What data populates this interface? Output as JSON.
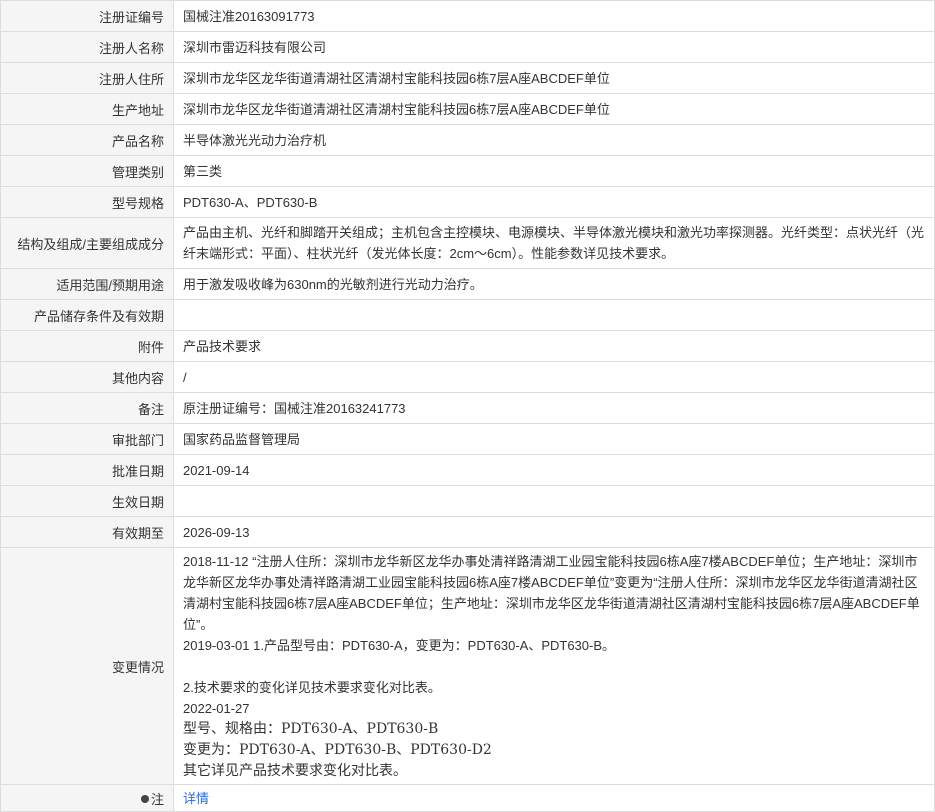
{
  "rows": [
    {
      "label": "注册证编号",
      "value": "国械注准20163091773"
    },
    {
      "label": "注册人名称",
      "value": "深圳市雷迈科技有限公司"
    },
    {
      "label": "注册人住所",
      "value": "深圳市龙华区龙华街道清湖社区清湖村宝能科技园6栋7层A座ABCDEF单位"
    },
    {
      "label": "生产地址",
      "value": "深圳市龙华区龙华街道清湖社区清湖村宝能科技园6栋7层A座ABCDEF单位"
    },
    {
      "label": "产品名称",
      "value": "半导体激光光动力治疗机"
    },
    {
      "label": "管理类别",
      "value": "第三类"
    },
    {
      "label": "型号规格",
      "value": "PDT630-A、PDT630-B"
    },
    {
      "label": "结构及组成/主要组成成分",
      "value": "产品由主机、光纤和脚踏开关组成；主机包含主控模块、电源模块、半导体激光模块和激光功率探测器。光纤类型：点状光纤（光纤末端形式：平面）、柱状光纤（发光体长度：2cm～6cm）。性能参数详见技术要求。"
    },
    {
      "label": "适用范围/预期用途",
      "value": "用于激发吸收峰为630nm的光敏剂进行光动力治疗。"
    },
    {
      "label": "产品储存条件及有效期",
      "value": ""
    },
    {
      "label": "附件",
      "value": "产品技术要求"
    },
    {
      "label": "其他内容",
      "value": "/"
    },
    {
      "label": "备注",
      "value": "原注册证编号：国械注准20163241773"
    },
    {
      "label": "审批部门",
      "value": "国家药品监督管理局"
    },
    {
      "label": "批准日期",
      "value": "2021-09-14"
    },
    {
      "label": "生效日期",
      "value": ""
    },
    {
      "label": "有效期至",
      "value": "2026-09-13"
    }
  ],
  "changes": {
    "label": "变更情况",
    "line1": "2018-11-12 “注册人住所：深圳市龙华新区龙华办事处清祥路清湖工业园宝能科技园6栋A座7楼ABCDEF单位；生产地址：深圳市龙华新区龙华办事处清祥路清湖工业园宝能科技园6栋A座7楼ABCDEF单位”变更为“注册人住所：深圳市龙华区龙华街道清湖社区清湖村宝能科技园6栋7层A座ABCDEF单位；生产地址：深圳市龙华区龙华街道清湖社区清湖村宝能科技园6栋7层A座ABCDEF单位”。",
    "line2": "2019-03-01 1.产品型号由：PDT630-A，变更为：PDT630-A、PDT630-B。",
    "line3": "2.技术要求的变化详见技术要求变化对比表。",
    "line4": "2022-01-27",
    "line5": "型号、规格由：PDT630-A、PDT630-B",
    "line6": "变更为：PDT630-A、PDT630-B、PDT630-D2",
    "line7": "其它详见产品技术要求变化对比表。"
  },
  "note": {
    "label": "注",
    "link": "详情",
    "icon": "pin-icon"
  }
}
